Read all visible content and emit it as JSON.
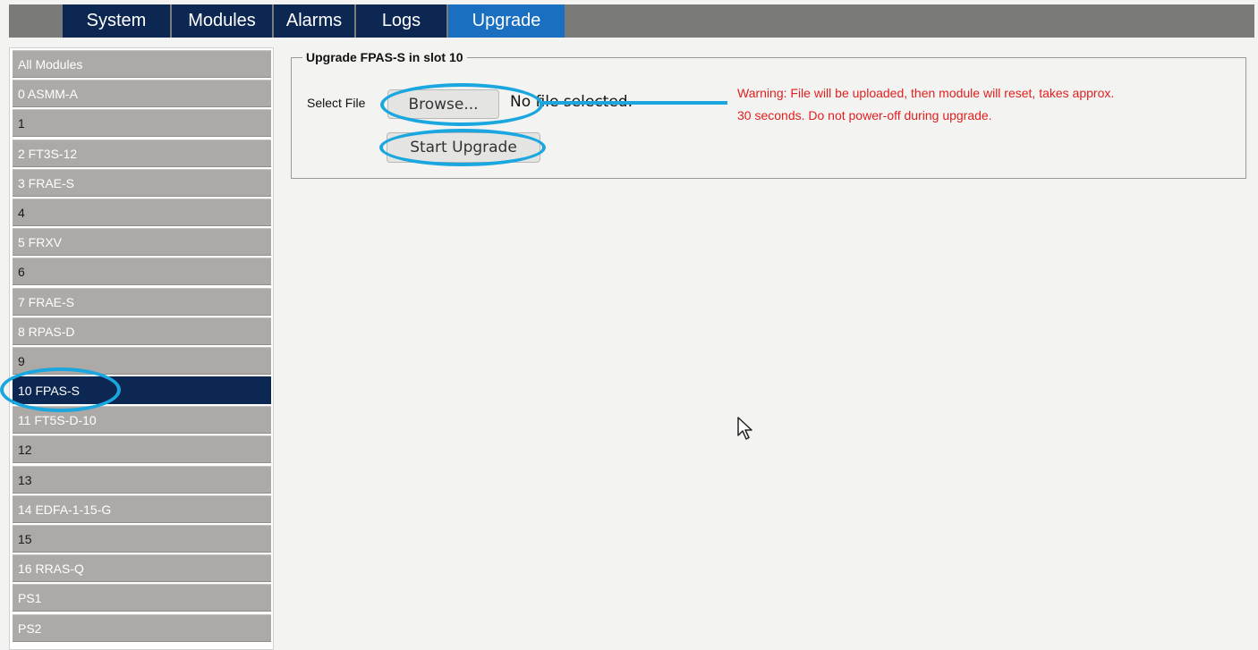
{
  "nav": {
    "tabs": [
      {
        "label": "System"
      },
      {
        "label": "Modules"
      },
      {
        "label": "Alarms"
      },
      {
        "label": "Logs"
      },
      {
        "label": "Upgrade"
      }
    ],
    "active": "Upgrade"
  },
  "sidebar": {
    "items": [
      {
        "label": "All Modules"
      },
      {
        "label": "0 ASMM-A"
      },
      {
        "label": "1"
      },
      {
        "label": "2 FT3S-12"
      },
      {
        "label": "3 FRAE-S"
      },
      {
        "label": "4"
      },
      {
        "label": "5 FRXV"
      },
      {
        "label": "6"
      },
      {
        "label": "7 FRAE-S"
      },
      {
        "label": "8 RPAS-D"
      },
      {
        "label": "9"
      },
      {
        "label": "10 FPAS-S"
      },
      {
        "label": "11 FT5S-D-10"
      },
      {
        "label": "12"
      },
      {
        "label": "13"
      },
      {
        "label": "14 EDFA-1-15-G"
      },
      {
        "label": "15"
      },
      {
        "label": "16 RRAS-Q"
      },
      {
        "label": "PS1"
      },
      {
        "label": "PS2"
      }
    ],
    "selected": "10 FPAS-S"
  },
  "upgrade": {
    "title": "Upgrade FPAS-S in slot 10",
    "select_file_label": "Select File",
    "browse_label": "Browse...",
    "file_status": "No file selected.",
    "start_label": "Start Upgrade",
    "warning_line1": "Warning: File will be uploaded, then module will reset, takes approx.",
    "warning_line2": "30 seconds. Do not power-off during upgrade."
  },
  "colors": {
    "nav_bg": "#0c2752",
    "nav_active": "#1b6fc1",
    "sidebar_item": "#ada9a6",
    "warning": "#e02020",
    "annotation": "#1aa7e0"
  }
}
